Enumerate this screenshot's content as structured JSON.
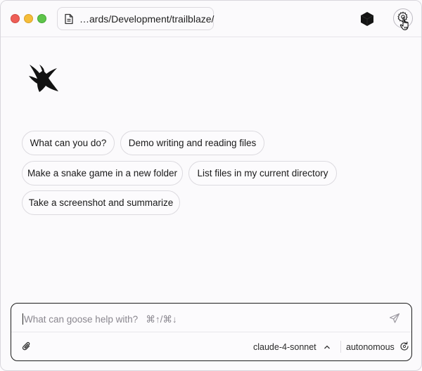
{
  "titlebar": {
    "path": "…ards/Development/trailblaze/",
    "icons": {
      "document": "document-icon",
      "extension": "cube-icon",
      "settings": "gear-icon",
      "cursor": "hand-pointer-icon"
    }
  },
  "logo": {
    "icon": "goose-logo-icon"
  },
  "suggestions": [
    "What can you do?",
    "Demo writing and reading files",
    "Make a snake game in a new folder",
    "List files in my current directory",
    "Take a screenshot and summarize"
  ],
  "composer": {
    "placeholder": "What can goose help with?   ⌘↑/⌘↓",
    "value": "",
    "model": "claude-4-sonnet",
    "mode": "autonomous",
    "icons": {
      "attach": "paperclip-icon",
      "send": "send-icon",
      "model_toggle": "chevron-up-icon",
      "mode": "refresh-icon"
    }
  },
  "colors": {
    "background": "#fbfafc",
    "border": "#dcdadf",
    "composer_border": "#1c1c1c",
    "close": "#ee5e57",
    "minimize": "#f5bd3a",
    "maximize": "#5ec44a"
  }
}
